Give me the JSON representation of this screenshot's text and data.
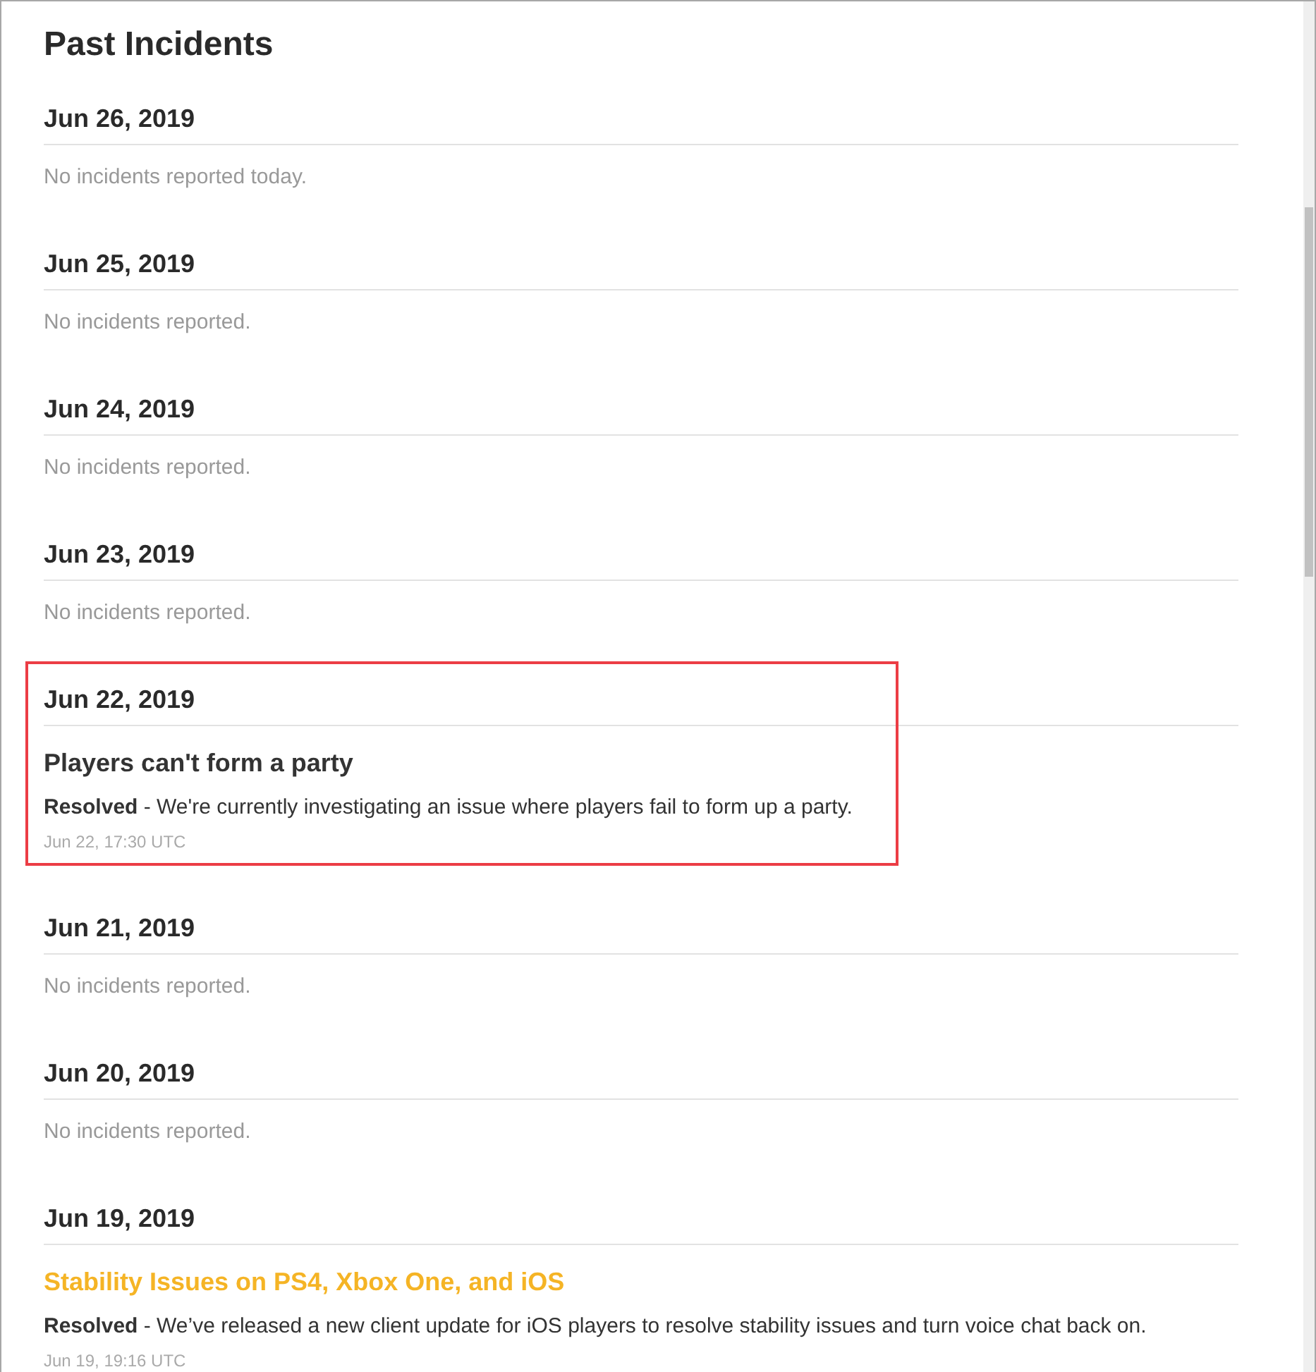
{
  "page_title": "Past Incidents",
  "days": [
    {
      "date": "Jun 26, 2019",
      "highlighted": false,
      "message": "No incidents reported today."
    },
    {
      "date": "Jun 25, 2019",
      "highlighted": false,
      "message": "No incidents reported."
    },
    {
      "date": "Jun 24, 2019",
      "highlighted": false,
      "message": "No incidents reported."
    },
    {
      "date": "Jun 23, 2019",
      "highlighted": false,
      "message": "No incidents reported."
    },
    {
      "date": "Jun 22, 2019",
      "highlighted": true,
      "incidents": [
        {
          "title": "Players can't form a party",
          "color": "#333333",
          "status": "Resolved",
          "body": " - We're currently investigating an issue where players fail to form up a party.",
          "time": "Jun 22, 17:30 UTC"
        }
      ]
    },
    {
      "date": "Jun 21, 2019",
      "highlighted": false,
      "message": "No incidents reported."
    },
    {
      "date": "Jun 20, 2019",
      "highlighted": false,
      "message": "No incidents reported."
    },
    {
      "date": "Jun 19, 2019",
      "highlighted": false,
      "incidents": [
        {
          "title": "Stability Issues on PS4, Xbox One, and iOS",
          "color": "#f5b425",
          "status": "Resolved",
          "body": " - We’ve released a new client update for iOS players to resolve stability issues and turn voice chat back on.",
          "time": "Jun 19, 19:16 UTC"
        }
      ]
    }
  ]
}
